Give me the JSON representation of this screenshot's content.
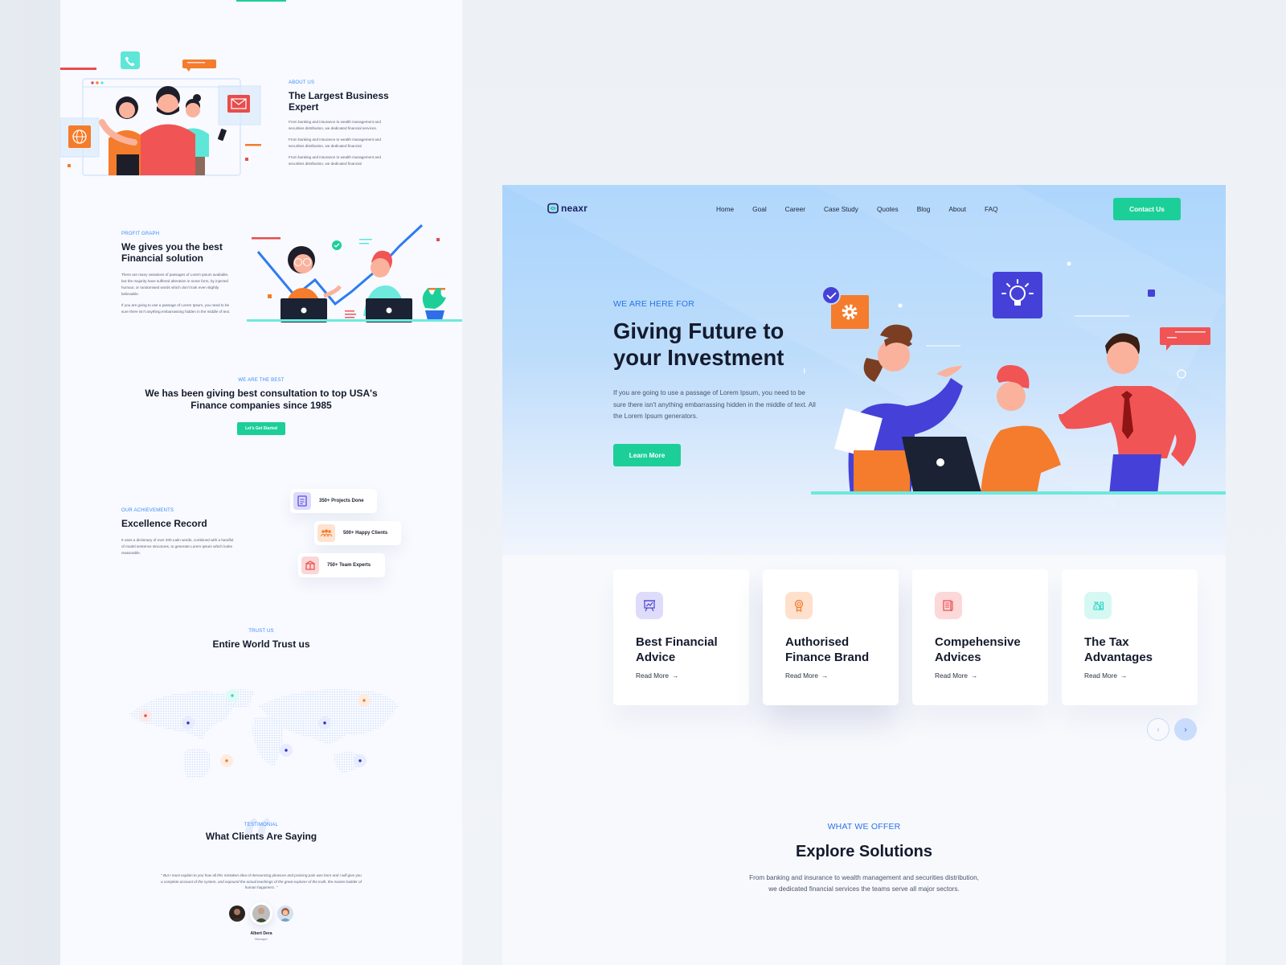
{
  "left": {
    "about": {
      "eyebrow": "ABOUT US",
      "title": "The Largest Business Expert",
      "paragraphs": [
        "From banking and insurance to wealth management and securities distribution, we dedicated financial services.",
        "From banking and insurance to wealth management and securities distribution, we dedicated financial",
        "From banking and insurance to wealth management and securities distribution, we dedicated financial"
      ]
    },
    "profit": {
      "eyebrow": "PROFIT GRAPH",
      "title": "We gives you the best Financial solution",
      "paragraphs": [
        "There are many variations of passages of Lorem Ipsum available, but the majority have suffered alteration in some form, by injected humour, or randomised words which don't look even slightly believable.",
        "If you are going to use a passage of Lorem Ipsum, you need to be sure there isn't anything embarrassing hidden in the middle of text."
      ]
    },
    "best": {
      "eyebrow": "WE ARE THE BEST",
      "title": "We has been giving best consultation to top USA's Finance companies since 1985",
      "button": "Let's Get Started"
    },
    "achievements": {
      "eyebrow": "OUR ACHIEVEMENTS",
      "title": "Excellence Record",
      "paragraph": "It uses a dictionary of over 200 Latin words, combined with a handful of model sentence structures, to generate Lorem Ipsum which looks reasonable.",
      "stats": [
        {
          "label": "350+ Projects Done",
          "icon": "clipboard-icon",
          "color": "#5b4fe0",
          "bg": "#dcdafa"
        },
        {
          "label": "500+ Happy Clients",
          "icon": "people-icon",
          "color": "#f47c2c",
          "bg": "#fde3d0"
        },
        {
          "label": "750+ Team Experts",
          "icon": "gift-icon",
          "color": "#e84c4c",
          "bg": "#fbd6d6"
        }
      ]
    },
    "trust": {
      "eyebrow": "TRUST US",
      "title": "Entire World Trust us"
    },
    "testimonial": {
      "eyebrow": "TESTIMONIAL",
      "title": "What Clients Are Saying",
      "quote": "\" But I must explain to you how all this mistaken idea of denouncing pleasure and praising pain was born and I will give you a complete account of the system, and expound the actual teachings of the great explorer of the truth, the master-builder of human happiness. \"",
      "author_name": "Albert Dera",
      "author_role": "Manager"
    }
  },
  "right": {
    "nav": {
      "logo": "neaxr",
      "links": [
        "Home",
        "Goal",
        "Career",
        "Case Study",
        "Quotes",
        "Blog",
        "About",
        "FAQ"
      ],
      "cta": "Contact Us"
    },
    "hero": {
      "eyebrow": "WE ARE HERE FOR",
      "title": "Giving Future to your Investment",
      "description": "If you are going to use a passage of Lorem Ipsum, you need to be sure there isn't anything embarrassing hidden in the middle of text. All the Lorem Ipsum generators.",
      "button": "Learn More"
    },
    "cards": [
      {
        "title": "Best Financial Advice",
        "link": "Read More",
        "icon": "presentation-chart-icon",
        "color": "#4b45d6",
        "bg": "#dedcfa"
      },
      {
        "title": "Authorised Finance Brand",
        "link": "Read More",
        "icon": "award-badge-icon",
        "color": "#f47c2c",
        "bg": "#fee0cc"
      },
      {
        "title": "Compehensive Advices",
        "link": "Read More",
        "icon": "document-pen-icon",
        "color": "#e84c4c",
        "bg": "#fcd8d8"
      },
      {
        "title": "The Tax Advantages",
        "link": "Read More",
        "icon": "money-bag-icon",
        "color": "#2fd6c3",
        "bg": "#d6f8f3"
      }
    ],
    "offer": {
      "eyebrow": "WHAT WE OFFER",
      "title": "Explore Solutions",
      "description": "From banking and insurance to wealth management and securities distribution, we dedicated financial services the teams serve all major sectors."
    }
  },
  "colors": {
    "accent_green": "#1ccf99",
    "accent_blue": "#2a73e8",
    "heading": "#141b2d"
  }
}
